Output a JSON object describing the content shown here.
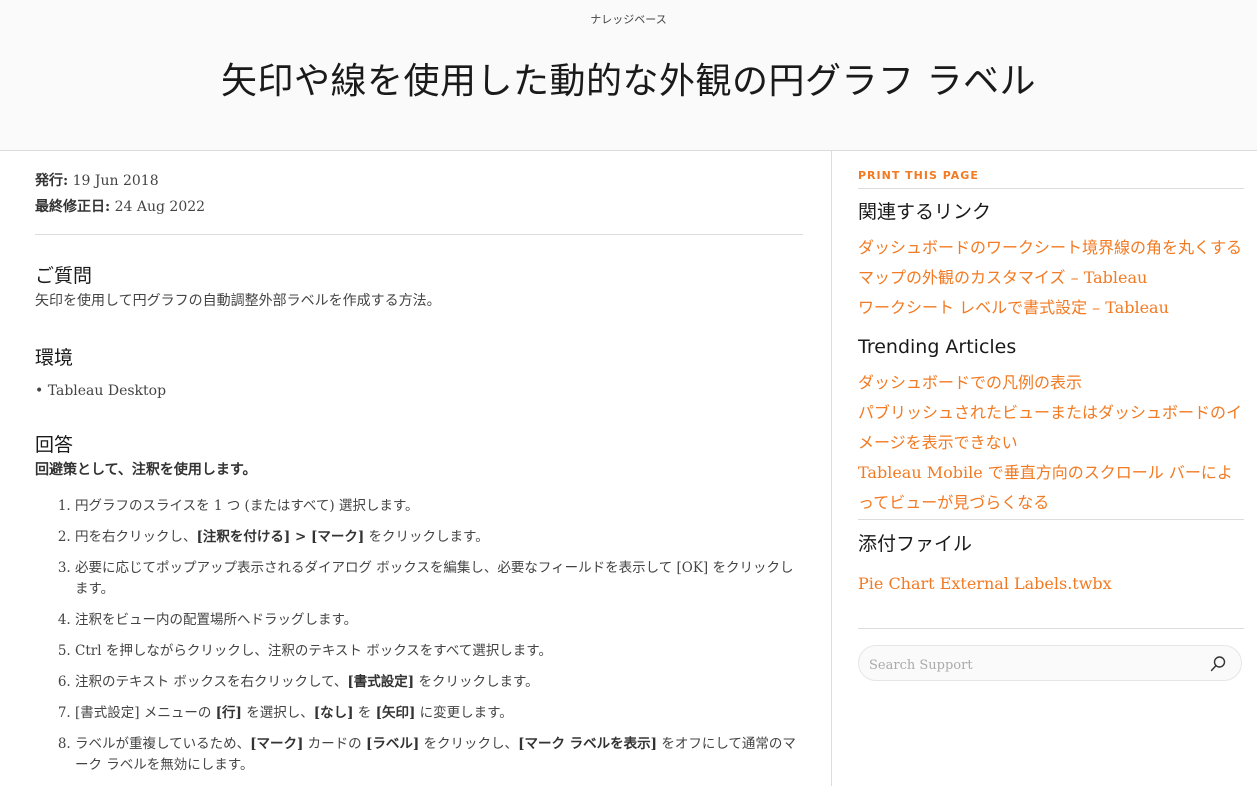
{
  "header": {
    "eyebrow": "ナレッジベース",
    "title": "矢印や線を使用した動的な外観の円グラフ ラベル"
  },
  "meta": {
    "published_label": "発行:",
    "published_value": "19 Jun 2018",
    "modified_label": "最終修正日:",
    "modified_value": "24 Aug 2022"
  },
  "sections": {
    "question": {
      "heading": "ご質問",
      "body": "矢印を使用して円グラフの自動調整外部ラベルを作成する方法。"
    },
    "environment": {
      "heading": "環境",
      "items": [
        "Tableau Desktop"
      ]
    },
    "answer": {
      "heading": "回答",
      "intro": "回避策として、注釈を使用します。",
      "steps": [
        {
          "parts": [
            {
              "t": "円グラフのスライスを 1 つ (またはすべて) 選択します。",
              "b": false
            }
          ]
        },
        {
          "parts": [
            {
              "t": "円を右クリックし、",
              "b": false
            },
            {
              "t": "[注釈を付ける] > [マーク]",
              "b": true
            },
            {
              "t": " をクリックします。",
              "b": false
            }
          ]
        },
        {
          "parts": [
            {
              "t": "必要に応じてポップアップ表示されるダイアログ ボックスを編集し、必要なフィールドを表示して [OK] をクリックします。",
              "b": false
            }
          ]
        },
        {
          "parts": [
            {
              "t": "注釈をビュー内の配置場所へドラッグします。",
              "b": false
            }
          ]
        },
        {
          "parts": [
            {
              "t": "Ctrl を押しながらクリックし、注釈のテキスト ボックスをすべて選択します。",
              "b": false
            }
          ]
        },
        {
          "parts": [
            {
              "t": "注釈のテキスト ボックスを右クリックして、",
              "b": false
            },
            {
              "t": "[書式設定]",
              "b": true
            },
            {
              "t": " をクリックします。",
              "b": false
            }
          ]
        },
        {
          "parts": [
            {
              "t": "[書式設定] メニューの ",
              "b": false
            },
            {
              "t": "[行]",
              "b": true
            },
            {
              "t": " を選択し、",
              "b": false
            },
            {
              "t": "[なし]",
              "b": true
            },
            {
              "t": " を ",
              "b": false
            },
            {
              "t": "[矢印]",
              "b": true
            },
            {
              "t": " に変更します。",
              "b": false
            }
          ]
        },
        {
          "parts": [
            {
              "t": "ラベルが重複しているため、",
              "b": false
            },
            {
              "t": "[マーク]",
              "b": true
            },
            {
              "t": " カードの ",
              "b": false
            },
            {
              "t": "[ラベル]",
              "b": true
            },
            {
              "t": " をクリックし、",
              "b": false
            },
            {
              "t": "[マーク ラベルを表示]",
              "b": true
            },
            {
              "t": " をオフにして通常のマーク ラベルを無効にします。",
              "b": false
            }
          ]
        }
      ]
    }
  },
  "sidebar": {
    "print_label": "PRINT THIS PAGE",
    "related": {
      "heading": "関連するリンク",
      "links": [
        "ダッシュボードのワークシート境界線の角を丸くする",
        "マップの外観のカスタマイズ – Tableau",
        "ワークシート レベルで書式設定 – Tableau"
      ]
    },
    "trending": {
      "heading": "Trending Articles",
      "links": [
        "ダッシュボードでの凡例の表示",
        "パブリッシュされたビューまたはダッシュボードのイメージを表示できない",
        "Tableau Mobile で垂直方向のスクロール バーによってビューが見づらくなる"
      ]
    },
    "attachments": {
      "heading": "添付ファイル",
      "files": [
        "Pie Chart External Labels.twbx"
      ]
    },
    "search": {
      "placeholder": "Search Support",
      "value": "",
      "icon": "search-icon"
    }
  },
  "colors": {
    "accent": "#f27a22",
    "header_bg": "#fafafa",
    "divider": "#dcdcdc"
  }
}
